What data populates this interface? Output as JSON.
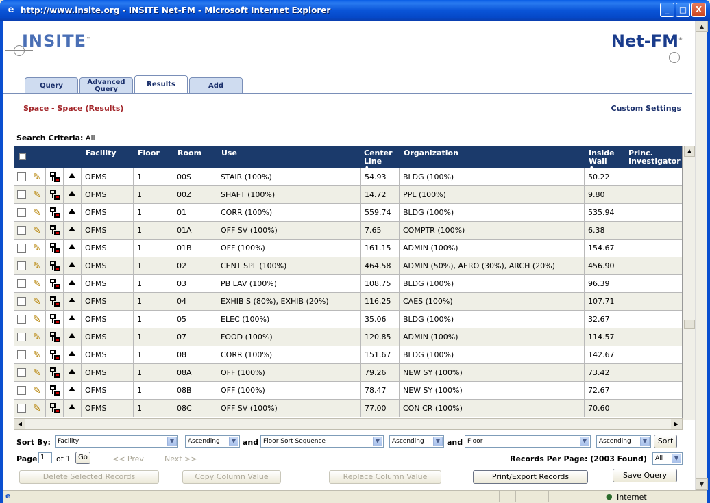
{
  "window": {
    "title": "http://www.insite.org - INSITE Net-FM - Microsoft Internet Explorer",
    "buttons": [
      "_",
      "□",
      "X"
    ]
  },
  "header": {
    "logo_left": "INSITE",
    "logo_left_tm": "™",
    "logo_right": "Net-FM",
    "logo_right_reg": "®"
  },
  "tabs": [
    {
      "label": "Query"
    },
    {
      "label": "Advanced Query"
    },
    {
      "label": "Results"
    },
    {
      "label": "Add"
    }
  ],
  "page": {
    "title": "Space - Space (Results)",
    "custom_settings": "Custom Settings",
    "search_criteria_label": "Search Criteria:",
    "search_criteria_value": "All"
  },
  "grid": {
    "columns": [
      "Facility",
      "Floor",
      "Room",
      "Use",
      "Center Line Area",
      "Organization",
      "Inside Wall Area",
      "Princ. Investigator"
    ],
    "rows": [
      [
        "OFMS",
        "1",
        "00S",
        "STAIR (100%)",
        "54.93",
        "BLDG (100%)",
        "50.22",
        ""
      ],
      [
        "OFMS",
        "1",
        "00Z",
        "SHAFT (100%)",
        "14.72",
        "PPL (100%)",
        "9.80",
        ""
      ],
      [
        "OFMS",
        "1",
        "01",
        "CORR (100%)",
        "559.74",
        "BLDG (100%)",
        "535.94",
        ""
      ],
      [
        "OFMS",
        "1",
        "01A",
        "OFF SV (100%)",
        "7.65",
        "COMPTR (100%)",
        "6.38",
        ""
      ],
      [
        "OFMS",
        "1",
        "01B",
        "OFF (100%)",
        "161.15",
        "ADMIN (100%)",
        "154.67",
        ""
      ],
      [
        "OFMS",
        "1",
        "02",
        "CENT SPL (100%)",
        "464.58",
        "ADMIN (50%), AERO (30%), ARCH (20%)",
        "456.90",
        ""
      ],
      [
        "OFMS",
        "1",
        "03",
        "PB LAV (100%)",
        "108.75",
        "BLDG (100%)",
        "96.39",
        ""
      ],
      [
        "OFMS",
        "1",
        "04",
        "EXHIB S (80%), EXHIB (20%)",
        "116.25",
        "CAES (100%)",
        "107.71",
        ""
      ],
      [
        "OFMS",
        "1",
        "05",
        "ELEC (100%)",
        "35.06",
        "BLDG (100%)",
        "32.67",
        ""
      ],
      [
        "OFMS",
        "1",
        "07",
        "FOOD (100%)",
        "120.85",
        "ADMIN (100%)",
        "114.57",
        ""
      ],
      [
        "OFMS",
        "1",
        "08",
        "CORR (100%)",
        "151.67",
        "BLDG (100%)",
        "142.67",
        ""
      ],
      [
        "OFMS",
        "1",
        "08A",
        "OFF (100%)",
        "79.26",
        "NEW SY (100%)",
        "73.42",
        ""
      ],
      [
        "OFMS",
        "1",
        "08B",
        "OFF (100%)",
        "78.47",
        "NEW SY (100%)",
        "72.67",
        ""
      ],
      [
        "OFMS",
        "1",
        "08C",
        "OFF SV (100%)",
        "77.00",
        "CON CR (100%)",
        "70.60",
        ""
      ]
    ]
  },
  "sort": {
    "label": "Sort By:",
    "and": "and",
    "field1": "Facility",
    "order1": "Ascending",
    "field2": "Floor Sort Sequence",
    "order2": "Ascending",
    "field3": "Floor",
    "order3": "Ascending",
    "sort_button": "Sort"
  },
  "paging": {
    "page_label": "Page",
    "page_value": "1",
    "of_label": "of 1",
    "go_button": "Go",
    "prev": "<< Prev",
    "next": "Next >>",
    "records_per_page": "Records Per Page: (2003 Found)",
    "records_per_page_value": "All"
  },
  "actions": {
    "delete": "Delete Selected Records",
    "copy": "Copy Column Value",
    "replace": "Replace Column Value",
    "print": "Print/Export Records",
    "save": "Save Query"
  },
  "status": {
    "zone": "Internet"
  }
}
